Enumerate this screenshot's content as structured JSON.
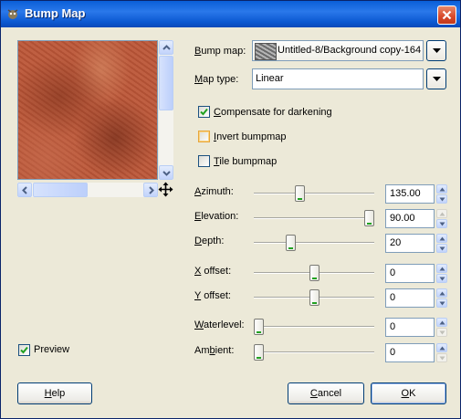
{
  "window": {
    "title": "Bump Map"
  },
  "preview": {
    "label": "Preview",
    "checked": true
  },
  "bump_map": {
    "label": "Bump map:",
    "accel": "B",
    "value": "Untitled-8/Background copy-164"
  },
  "map_type": {
    "label": "Map type:",
    "accel": "M",
    "value": "Linear"
  },
  "checkboxes": [
    {
      "label": "Compensate for darkening",
      "accel": "C",
      "checked": true
    },
    {
      "label": "Invert bumpmap",
      "accel": "I",
      "checked": false
    },
    {
      "label": "Tile bumpmap",
      "accel": "T",
      "checked": false
    }
  ],
  "sliders": [
    {
      "label": "Azimuth:",
      "accel": "A",
      "value": "135.00",
      "level": 0.375
    },
    {
      "label": "Elevation:",
      "accel": "E",
      "value": "90.00",
      "level": 1.0
    },
    {
      "label": "Depth:",
      "accel": "D",
      "value": "20",
      "level": 0.29
    },
    {
      "label": "X offset:",
      "accel": "X",
      "value": "0",
      "level": 0.5
    },
    {
      "label": "Y offset:",
      "accel": "Y",
      "value": "0",
      "level": 0.5
    },
    {
      "label": "Waterlevel:",
      "accel": "W",
      "value": "0",
      "level": 0.0
    },
    {
      "label": "Ambient:",
      "accel": "b",
      "value": "0",
      "level": 0.0
    }
  ],
  "buttons": {
    "help": "Help",
    "cancel": "Cancel",
    "ok": "OK"
  },
  "colors": {
    "title_bar": "#0a5fd8",
    "window_bg": "#ece9d8",
    "close": "#d8482a",
    "check": "#21a121"
  }
}
